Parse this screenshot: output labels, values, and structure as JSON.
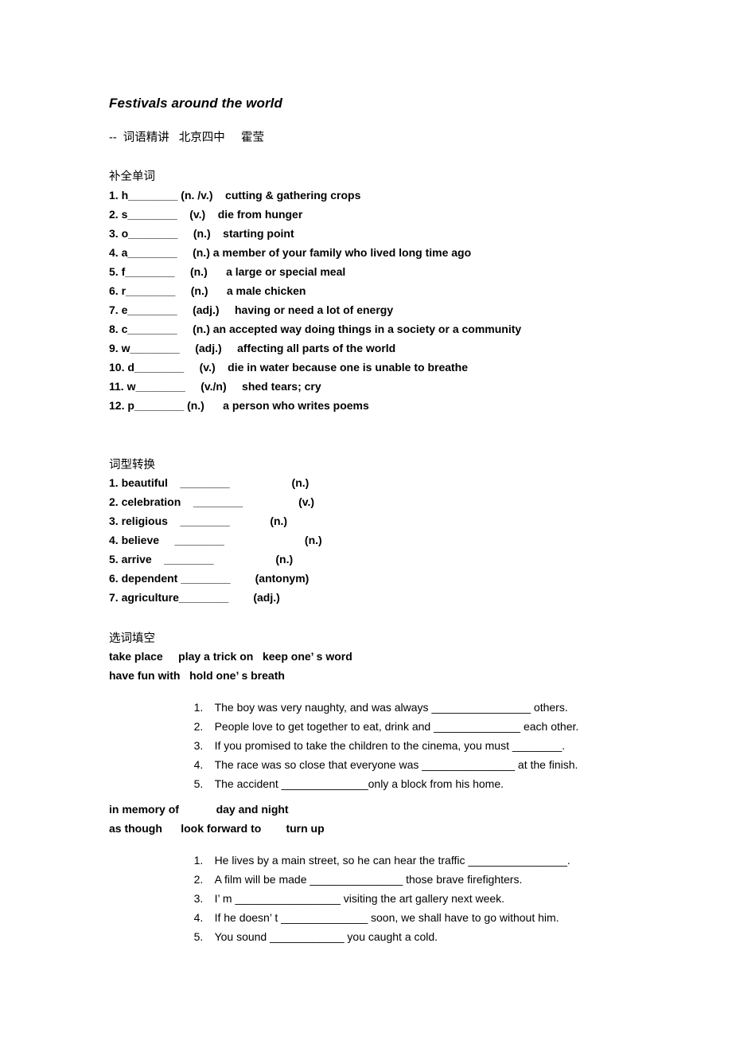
{
  "document": {
    "title": "Festivals around the world",
    "byline": "--  词语精讲   北京四中     霍莹"
  },
  "section_word_completion": {
    "heading": "补全单词",
    "items": [
      "1. h________ (n. /v.)    cutting & gathering crops",
      "2. s________    (v.)    die from hunger",
      "3. o________     (n.)    starting point",
      "4. a________     (n.) a member of your family who lived long time ago",
      "5. f________     (n.)      a large or special meal",
      "6. r________     (n.)      a male chicken",
      "7. e________     (adj.)     having or need a lot of energy",
      "8. c________     (n.) an accepted way doing things in a society or a community",
      "9. w________     (adj.)     affecting all parts of the world",
      "10. d________     (v.)    die in water because one is unable to breathe",
      "11. w________     (v./n)     shed tears; cry",
      "12. p________ (n.)      a person who writes poems"
    ]
  },
  "section_word_forms": {
    "heading": "词型转换",
    "items": [
      "1. beautiful    ________                    (n.)",
      "2. celebration    ________                  (v.)",
      "3. religious    ________             (n.)",
      "4. believe     ________                          (n.)",
      "5. arrive    ________                    (n.)",
      "6. dependent ________        (antonym)",
      "7. agriculture________        (adj.)"
    ]
  },
  "section_fill_in": {
    "heading": "选词填空",
    "phrase_bank_1": [
      "take place     play a trick on   keep one’ s word",
      "have fun with   hold one’ s breath"
    ],
    "sentences_1": [
      {
        "num": "1.",
        "text": "The boy was very naughty, and was always ________________ others."
      },
      {
        "num": "2.",
        "text": "People love to get together to eat, drink and ______________ each other."
      },
      {
        "num": "3.",
        "text": "If you promised to take the children to the cinema, you must ________."
      },
      {
        "num": "4.",
        "text": "The race was so close that everyone was _______________ at the finish."
      },
      {
        "num": "5.",
        "text": "The accident ______________only a block from his home."
      }
    ],
    "phrase_bank_2": [
      "in memory of            day and night",
      "as though      look forward to        turn up"
    ],
    "sentences_2": [
      {
        "num": "1.",
        "text": "He lives by a main street, so he can hear the traffic ________________."
      },
      {
        "num": "2.",
        "text": "A film will be made _______________ those brave firefighters."
      },
      {
        "num": "3.",
        "text": "I’ m _________________ visiting the art gallery next week."
      },
      {
        "num": "4.",
        "text": "If he doesn’ t ______________ soon, we shall have to go without him."
      },
      {
        "num": "5.",
        "text": "You sound ____________ you caught a cold."
      }
    ]
  }
}
